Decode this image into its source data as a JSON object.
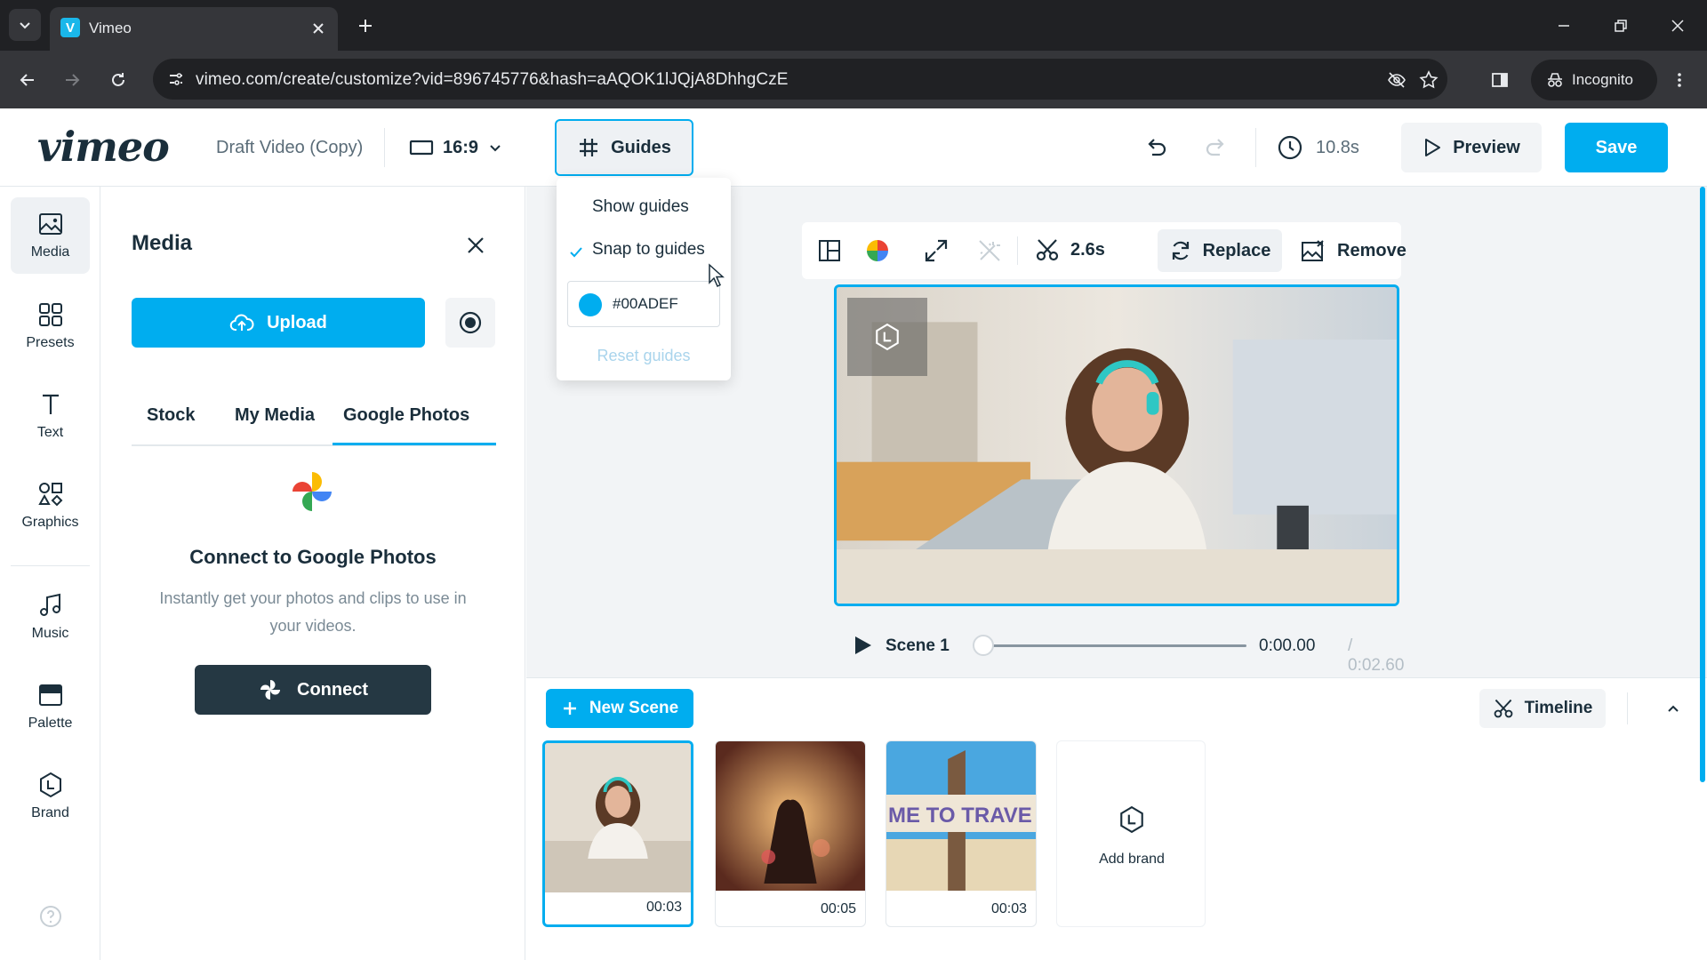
{
  "browser": {
    "tab_title": "Vimeo",
    "favicon_letter": "V",
    "url": "vimeo.com/create/customize?vid=896745776&hash=aAQOK1lJQjA8DhhgCzE",
    "profile_label": "Incognito"
  },
  "header": {
    "logo": "vimeo",
    "draft_title": "Draft Video (Copy)",
    "aspect_ratio": "16:9",
    "guides_label": "Guides",
    "duration": "10.8s",
    "preview_label": "Preview",
    "save_label": "Save"
  },
  "rail": {
    "items": [
      {
        "label": "Media",
        "icon": "image-icon"
      },
      {
        "label": "Presets",
        "icon": "grid-icon"
      },
      {
        "label": "Text",
        "icon": "text-icon"
      },
      {
        "label": "Graphics",
        "icon": "shapes-icon"
      },
      {
        "label": "Music",
        "icon": "music-icon"
      },
      {
        "label": "Palette",
        "icon": "palette-icon"
      },
      {
        "label": "Brand",
        "icon": "brand-icon"
      }
    ]
  },
  "media_panel": {
    "title": "Media",
    "upload_label": "Upload",
    "tabs": [
      {
        "label": "Stock"
      },
      {
        "label": "My Media"
      },
      {
        "label": "Google Photos",
        "active": true
      }
    ],
    "connect_title": "Connect to Google Photos",
    "connect_desc": "Instantly get your photos and clips to use in your videos.",
    "connect_label": "Connect"
  },
  "guides_menu": {
    "show_guides": "Show guides",
    "snap_to_guides": "Snap to guides",
    "snap_checked": true,
    "color_hex": "#00ADEF",
    "reset_label": "Reset guides"
  },
  "toolbar": {
    "trim_duration": "2.6s",
    "replace_label": "Replace",
    "remove_label": "Remove"
  },
  "player": {
    "scene_label": "Scene 1",
    "current_time": "0:00.00",
    "total_time": "/ 0:02.60",
    "progress": 0
  },
  "timeline": {
    "new_scene_label": "New Scene",
    "timeline_label": "Timeline",
    "scenes": [
      {
        "duration": "00:03"
      },
      {
        "duration": "00:05"
      },
      {
        "duration": "00:03",
        "sign_text": "ME TO TRAVE"
      }
    ],
    "add_brand_label": "Add brand"
  },
  "colors": {
    "accent": "#00adef",
    "dark_button": "#253843"
  }
}
